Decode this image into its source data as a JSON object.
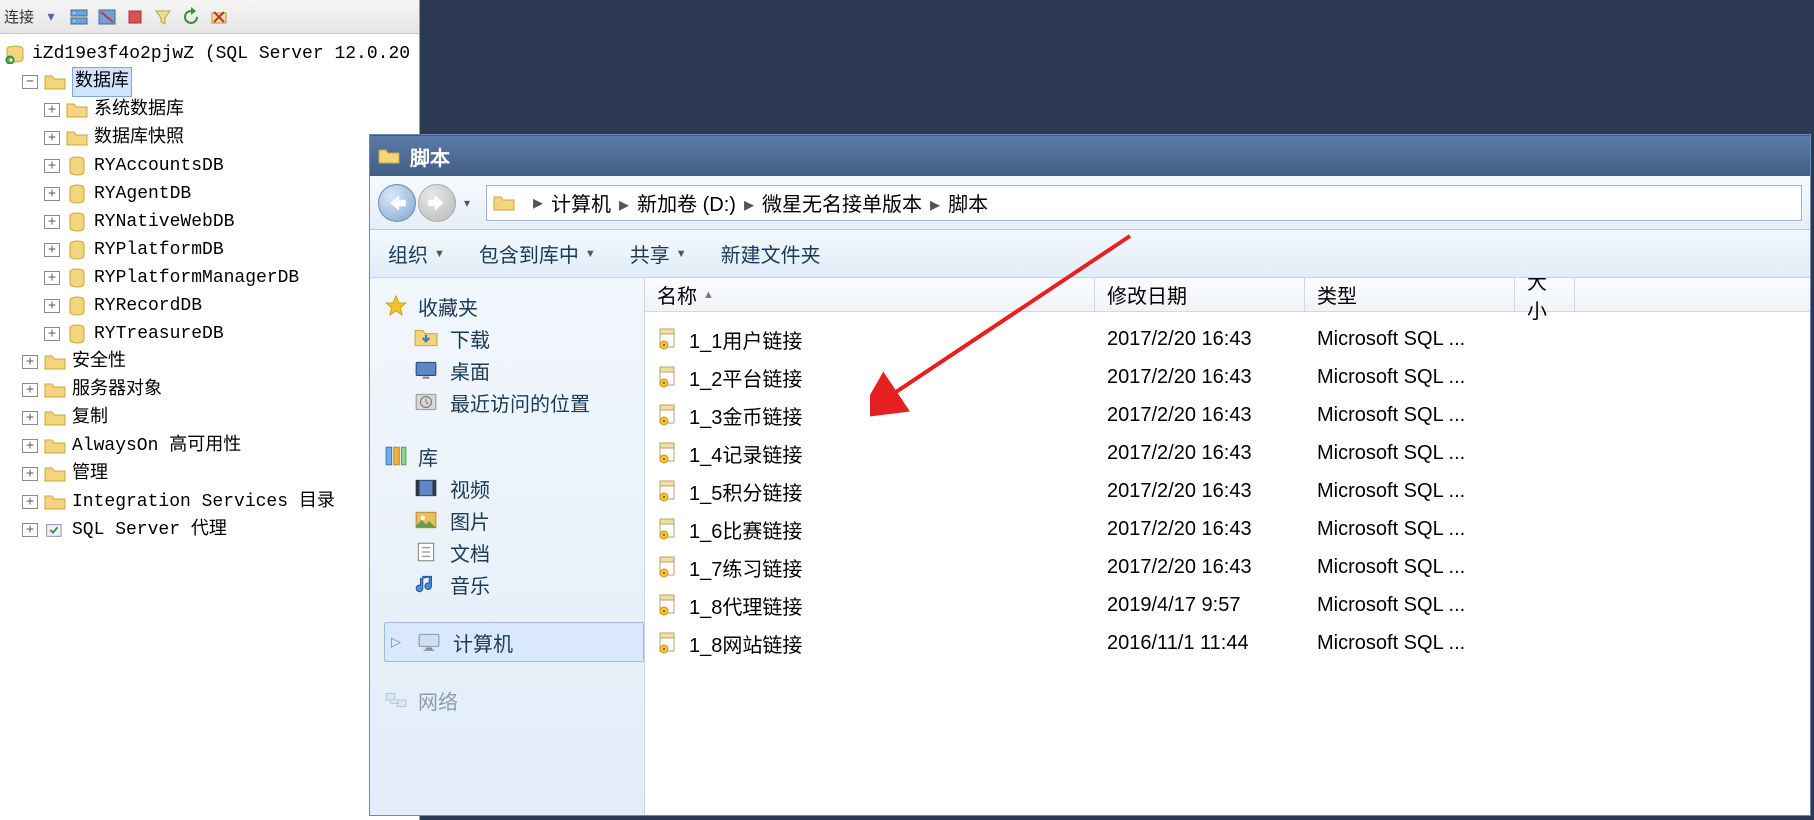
{
  "ssms": {
    "toolbar_label": "连接",
    "server": "iZd19e3f4o2pjwZ (SQL Server 12.0.20",
    "databases_label": "数据库",
    "sysdb_label": "系统数据库",
    "snapshot_label": "数据库快照",
    "dbs": [
      "RYAccountsDB",
      "RYAgentDB",
      "RYNativeWebDB",
      "RYPlatformDB",
      "RYPlatformManagerDB",
      "RYRecordDB",
      "RYTreasureDB"
    ],
    "nodes": [
      "安全性",
      "服务器对象",
      "复制",
      "AlwaysOn 高可用性",
      "管理",
      "Integration Services 目录",
      "SQL Server 代理"
    ]
  },
  "explorer": {
    "title": "脚本",
    "breadcrumb": [
      "计算机",
      "新加卷 (D:)",
      "微星无名接单版本",
      "脚本"
    ],
    "menu": {
      "organize": "组织",
      "include": "包含到库中",
      "share": "共享",
      "newfolder": "新建文件夹"
    },
    "nav": {
      "favorites": "收藏夹",
      "downloads": "下载",
      "desktop": "桌面",
      "recent": "最近访问的位置",
      "libraries": "库",
      "videos": "视频",
      "pictures": "图片",
      "documents": "文档",
      "music": "音乐",
      "computer": "计算机",
      "network": "网络"
    },
    "columns": {
      "name": "名称",
      "date": "修改日期",
      "type": "类型",
      "size": "大小"
    },
    "col_widths": {
      "name": 450,
      "date": 210,
      "type": 210,
      "size": 60
    },
    "files": [
      {
        "name": "1_1用户链接",
        "date": "2017/2/20 16:43",
        "type": "Microsoft SQL ..."
      },
      {
        "name": "1_2平台链接",
        "date": "2017/2/20 16:43",
        "type": "Microsoft SQL ..."
      },
      {
        "name": "1_3金币链接",
        "date": "2017/2/20 16:43",
        "type": "Microsoft SQL ..."
      },
      {
        "name": "1_4记录链接",
        "date": "2017/2/20 16:43",
        "type": "Microsoft SQL ..."
      },
      {
        "name": "1_5积分链接",
        "date": "2017/2/20 16:43",
        "type": "Microsoft SQL ..."
      },
      {
        "name": "1_6比赛链接",
        "date": "2017/2/20 16:43",
        "type": "Microsoft SQL ..."
      },
      {
        "name": "1_7练习链接",
        "date": "2017/2/20 16:43",
        "type": "Microsoft SQL ..."
      },
      {
        "name": "1_8代理链接",
        "date": "2019/4/17 9:57",
        "type": "Microsoft SQL ..."
      },
      {
        "name": "1_8网站链接",
        "date": "2016/11/1 11:44",
        "type": "Microsoft SQL ..."
      }
    ]
  }
}
